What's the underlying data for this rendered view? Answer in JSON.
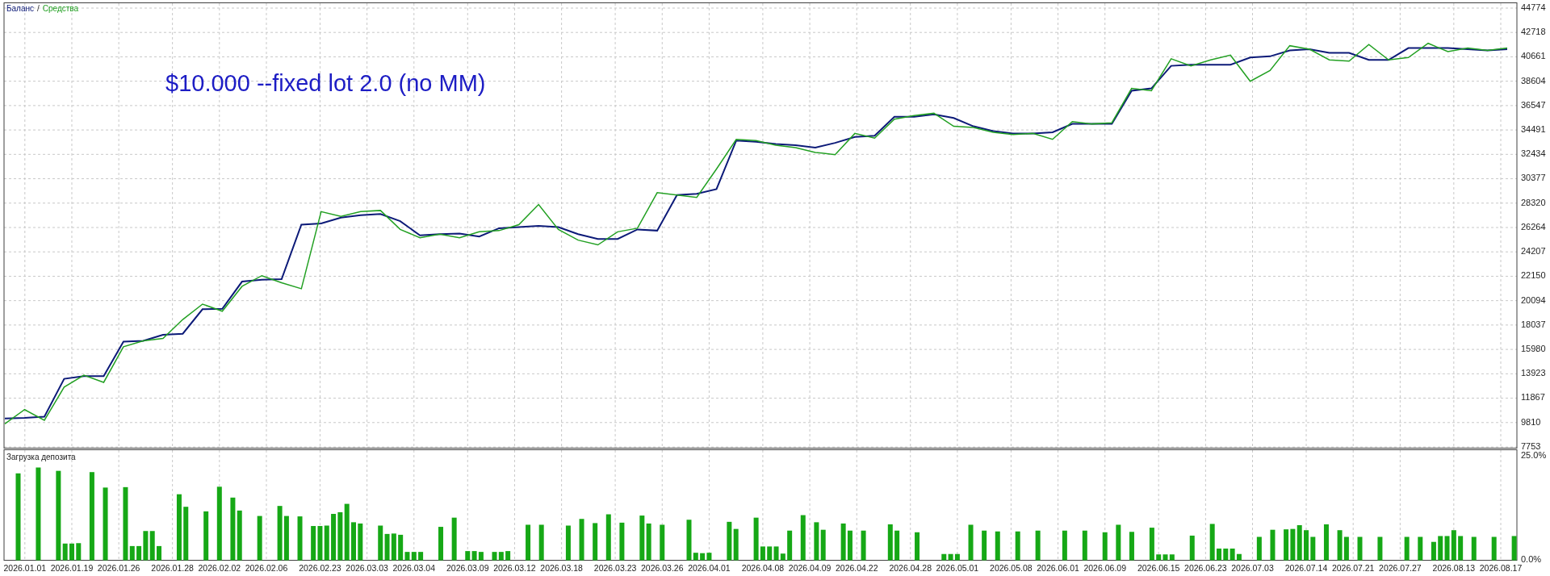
{
  "main_chart": {
    "legend_separator": "/",
    "annotation": "$10.000 --fixed lot 2.0 (no MM)",
    "chart_data": {
      "type": "line",
      "grid": true,
      "ylim": [
        7753,
        44774
      ],
      "yticks": [
        44774,
        42718,
        40661,
        38604,
        36547,
        34491,
        32434,
        30377,
        28320,
        26264,
        24207,
        22150,
        20094,
        18037,
        15980,
        13923,
        11867,
        9810,
        7753
      ],
      "series": [
        {
          "name": "Баланс",
          "color": "#0c1a78",
          "values": [
            10160,
            10200,
            10300,
            13500,
            13730,
            13730,
            16630,
            16700,
            17210,
            17300,
            19370,
            19400,
            21700,
            21860,
            21900,
            26510,
            26600,
            27100,
            27300,
            27400,
            26800,
            25600,
            25700,
            25760,
            25500,
            26200,
            26300,
            26400,
            26300,
            25700,
            25300,
            25300,
            26100,
            26000,
            29000,
            29100,
            29500,
            33600,
            33500,
            33300,
            33200,
            33000,
            33400,
            33900,
            34000,
            35600,
            35600,
            35800,
            35500,
            34800,
            34400,
            34200,
            34200,
            34300,
            35000,
            35000,
            35000,
            37800,
            38000,
            39900,
            40000,
            40000,
            40000,
            40600,
            40700,
            41200,
            41300,
            41000,
            41000,
            40400,
            40400,
            41400,
            41400,
            41400,
            41300,
            41200,
            41300
          ]
        },
        {
          "name": "Средства",
          "color": "#22a022",
          "values": [
            9700,
            10900,
            10000,
            12800,
            13800,
            13200,
            16200,
            16700,
            16900,
            18500,
            19800,
            19200,
            21300,
            22200,
            21600,
            21100,
            27600,
            27200,
            27600,
            27700,
            26100,
            25400,
            25700,
            25400,
            25900,
            26000,
            26500,
            28200,
            26100,
            25200,
            24800,
            25900,
            26200,
            29200,
            29000,
            28800,
            31200,
            33700,
            33600,
            33200,
            33000,
            32600,
            32400,
            34200,
            33800,
            35400,
            35700,
            35900,
            34800,
            34700,
            34300,
            34100,
            34200,
            33700,
            35200,
            35000,
            35100,
            38000,
            37800,
            40500,
            39900,
            40400,
            40800,
            38600,
            39500,
            41600,
            41300,
            40400,
            40300,
            41700,
            40400,
            40600,
            41800,
            41100,
            41400,
            41200,
            41400
          ]
        }
      ]
    }
  },
  "deposit_load_chart": {
    "title": "Загрузка депозита",
    "chart_data": {
      "type": "bar",
      "grid": true,
      "ylim": [
        0,
        26.45
      ],
      "yticks": [
        {
          "value": 25,
          "label": "25.0%"
        },
        {
          "value": 0,
          "label": "0.0%"
        }
      ],
      "categories": [
        null,
        "2026.01.01",
        null,
        null,
        null,
        null,
        null,
        null,
        "2026.01.19",
        null,
        null,
        null,
        null,
        null,
        null,
        "2026.01.26",
        null,
        null,
        null,
        null,
        null,
        null,
        null,
        "2026.01.28",
        null,
        null,
        null,
        null,
        null,
        null,
        "2026.02.02",
        null,
        null,
        null,
        null,
        null,
        null,
        "2026.02.06",
        null,
        null,
        null,
        null,
        null,
        null,
        null,
        "2026.02.23",
        null,
        null,
        null,
        null,
        null,
        null,
        "2026.03.03",
        null,
        null,
        null,
        null,
        null,
        null,
        "2026.03.04",
        null,
        null,
        null,
        null,
        null,
        null,
        null,
        "2026.03.09",
        null,
        null,
        null,
        null,
        null,
        null,
        "2026.03.12",
        null,
        null,
        null,
        null,
        null,
        null,
        "2026.03.18",
        null,
        null,
        null,
        null,
        null,
        null,
        null,
        "2026.03.23",
        null,
        null,
        null,
        null,
        null,
        null,
        "2026.03.26",
        null,
        null,
        null,
        null,
        null,
        null,
        "2026.04.01",
        null,
        null,
        null,
        null,
        null,
        null,
        null,
        "2026.04.08",
        null,
        null,
        null,
        null,
        null,
        null,
        "2026.04.09",
        null,
        null,
        null,
        null,
        null,
        null,
        "2026.04.22",
        null,
        null,
        null,
        null,
        null,
        null,
        null,
        "2026.04.28",
        null,
        null,
        null,
        null,
        null,
        null,
        "2026.05.01",
        null,
        null,
        null,
        null,
        null,
        null,
        null,
        "2026.05.08",
        null,
        null,
        null,
        null,
        null,
        null,
        "2026.06.01",
        null,
        null,
        null,
        null,
        null,
        null,
        "2026.06.09",
        null,
        null,
        null,
        null,
        null,
        null,
        null,
        "2026.06.15",
        null,
        null,
        null,
        null,
        null,
        null,
        "2026.06.23",
        null,
        null,
        null,
        null,
        null,
        null,
        "2026.07.03",
        null,
        null,
        null,
        null,
        null,
        null,
        null,
        "2026.07.14",
        null,
        null,
        null,
        null,
        null,
        null,
        "2026.07.21",
        null,
        null,
        null,
        null,
        null,
        null,
        "2026.07.27",
        null,
        null,
        null,
        null,
        null,
        null,
        null,
        "2026.08.13",
        null,
        null,
        null,
        null,
        null,
        null,
        "2026.08.17",
        null,
        null
      ],
      "series": [
        {
          "color": "#16a816",
          "values": [
            20.8,
            null,
            null,
            22.2,
            null,
            null,
            21.4,
            4.0,
            4.0,
            4.1,
            null,
            21.1,
            null,
            17.4,
            null,
            null,
            17.5,
            3.4,
            3.4,
            7.0,
            7.0,
            3.4,
            null,
            null,
            15.8,
            12.8,
            null,
            null,
            11.7,
            null,
            17.6,
            null,
            15.0,
            11.9,
            null,
            null,
            10.6,
            null,
            null,
            13.0,
            10.6,
            null,
            10.5,
            null,
            8.2,
            8.2,
            8.3,
            11.1,
            11.5,
            13.5,
            9.1,
            8.8,
            null,
            null,
            8.3,
            6.3,
            6.4,
            6.1,
            2.0,
            2.0,
            2.0,
            null,
            null,
            8.0,
            null,
            10.2,
            null,
            2.2,
            2.2,
            2.0,
            null,
            2.0,
            2.0,
            2.2,
            null,
            null,
            8.5,
            null,
            8.5,
            null,
            null,
            null,
            8.3,
            null,
            9.9,
            null,
            8.9,
            null,
            11.0,
            null,
            9.0,
            null,
            null,
            10.7,
            8.8,
            null,
            8.5,
            null,
            null,
            null,
            9.7,
            1.8,
            1.7,
            1.8,
            null,
            null,
            9.2,
            7.5,
            null,
            null,
            10.2,
            3.3,
            3.3,
            3.3,
            1.6,
            7.1,
            null,
            10.8,
            null,
            9.1,
            7.3,
            null,
            null,
            8.8,
            7.1,
            null,
            7.1,
            null,
            null,
            null,
            8.6,
            7.1,
            null,
            null,
            6.7,
            null,
            null,
            null,
            1.5,
            1.5,
            1.5,
            null,
            8.5,
            null,
            7.1,
            null,
            6.9,
            null,
            null,
            6.9,
            null,
            null,
            7.1,
            null,
            null,
            null,
            7.1,
            null,
            null,
            7.1,
            null,
            null,
            6.7,
            null,
            8.5,
            null,
            6.8,
            null,
            null,
            7.8,
            1.4,
            1.4,
            1.4,
            null,
            null,
            5.9,
            null,
            null,
            8.7,
            2.8,
            2.8,
            2.8,
            1.5,
            null,
            null,
            5.6,
            null,
            7.3,
            null,
            7.4,
            7.5,
            8.4,
            7.2,
            5.6,
            null,
            8.6,
            null,
            7.2,
            5.6,
            null,
            5.6,
            null,
            null,
            5.6,
            null,
            null,
            null,
            5.6,
            null,
            5.6,
            null,
            4.4,
            5.8,
            5.8,
            7.2,
            5.8,
            null,
            5.6,
            null,
            null,
            5.6,
            null,
            null,
            5.8
          ]
        }
      ]
    }
  }
}
